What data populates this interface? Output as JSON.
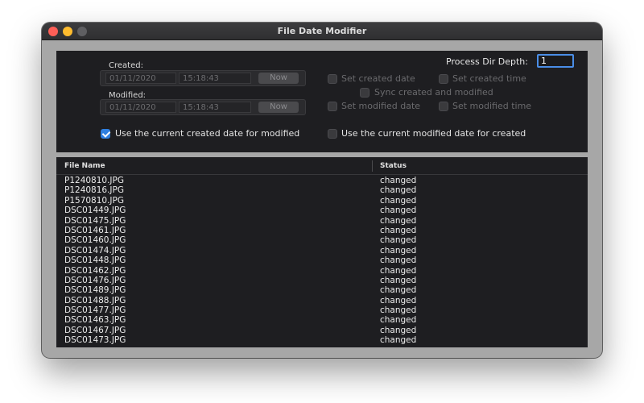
{
  "window": {
    "title": "File Date Modifier"
  },
  "created": {
    "label": "Created:",
    "date": "01/11/2020",
    "time": "15:18:43",
    "now_label": "Now"
  },
  "modified": {
    "label": "Modified:",
    "date": "01/11/2020",
    "time": "15:18:43",
    "now_label": "Now"
  },
  "depth": {
    "label": "Process Dir Depth:",
    "value": "1"
  },
  "options": {
    "set_created_date": "Set created date",
    "set_created_time": "Set created time",
    "sync": "Sync created and modified",
    "set_modified_date": "Set modified date",
    "set_modified_time": "Set modified time",
    "use_created_for_modified": "Use the current created date for modified",
    "use_modified_for_created": "Use the current modified date for created"
  },
  "table": {
    "columns": [
      "File Name",
      "Status"
    ],
    "rows": [
      [
        "P1240810.JPG",
        "changed"
      ],
      [
        "P1240816.JPG",
        "changed"
      ],
      [
        "P1570810.JPG",
        "changed"
      ],
      [
        "DSC01449.JPG",
        "changed"
      ],
      [
        "DSC01475.JPG",
        "changed"
      ],
      [
        "DSC01461.JPG",
        "changed"
      ],
      [
        "DSC01460.JPG",
        "changed"
      ],
      [
        "DSC01474.JPG",
        "changed"
      ],
      [
        "DSC01448.JPG",
        "changed"
      ],
      [
        "DSC01462.JPG",
        "changed"
      ],
      [
        "DSC01476.JPG",
        "changed"
      ],
      [
        "DSC01489.JPG",
        "changed"
      ],
      [
        "DSC01488.JPG",
        "changed"
      ],
      [
        "DSC01477.JPG",
        "changed"
      ],
      [
        "DSC01463.JPG",
        "changed"
      ],
      [
        "DSC01467.JPG",
        "changed"
      ],
      [
        "DSC01473.JPG",
        "changed"
      ]
    ]
  },
  "colors": {
    "accent": "#2f7fe0",
    "focus_ring": "#4a8de6",
    "panel": "#1e1e21",
    "window": "#a7a7a7"
  }
}
